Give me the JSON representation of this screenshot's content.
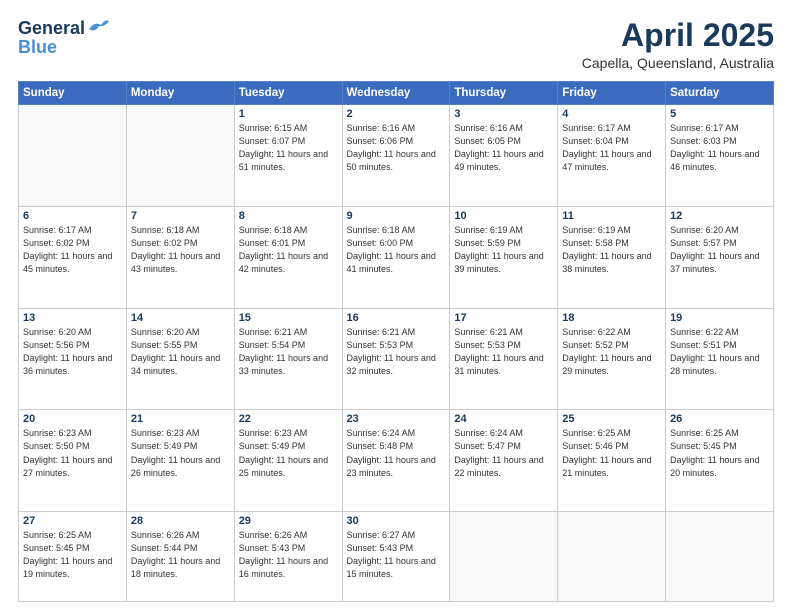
{
  "logo": {
    "general": "General",
    "blue": "Blue"
  },
  "header": {
    "month": "April 2025",
    "location": "Capella, Queensland, Australia"
  },
  "weekdays": [
    "Sunday",
    "Monday",
    "Tuesday",
    "Wednesday",
    "Thursday",
    "Friday",
    "Saturday"
  ],
  "weeks": [
    [
      {
        "day": "",
        "detail": ""
      },
      {
        "day": "",
        "detail": ""
      },
      {
        "day": "1",
        "detail": "Sunrise: 6:15 AM\nSunset: 6:07 PM\nDaylight: 11 hours and 51 minutes."
      },
      {
        "day": "2",
        "detail": "Sunrise: 6:16 AM\nSunset: 6:06 PM\nDaylight: 11 hours and 50 minutes."
      },
      {
        "day": "3",
        "detail": "Sunrise: 6:16 AM\nSunset: 6:05 PM\nDaylight: 11 hours and 49 minutes."
      },
      {
        "day": "4",
        "detail": "Sunrise: 6:17 AM\nSunset: 6:04 PM\nDaylight: 11 hours and 47 minutes."
      },
      {
        "day": "5",
        "detail": "Sunrise: 6:17 AM\nSunset: 6:03 PM\nDaylight: 11 hours and 46 minutes."
      }
    ],
    [
      {
        "day": "6",
        "detail": "Sunrise: 6:17 AM\nSunset: 6:02 PM\nDaylight: 11 hours and 45 minutes."
      },
      {
        "day": "7",
        "detail": "Sunrise: 6:18 AM\nSunset: 6:02 PM\nDaylight: 11 hours and 43 minutes."
      },
      {
        "day": "8",
        "detail": "Sunrise: 6:18 AM\nSunset: 6:01 PM\nDaylight: 11 hours and 42 minutes."
      },
      {
        "day": "9",
        "detail": "Sunrise: 6:18 AM\nSunset: 6:00 PM\nDaylight: 11 hours and 41 minutes."
      },
      {
        "day": "10",
        "detail": "Sunrise: 6:19 AM\nSunset: 5:59 PM\nDaylight: 11 hours and 39 minutes."
      },
      {
        "day": "11",
        "detail": "Sunrise: 6:19 AM\nSunset: 5:58 PM\nDaylight: 11 hours and 38 minutes."
      },
      {
        "day": "12",
        "detail": "Sunrise: 6:20 AM\nSunset: 5:57 PM\nDaylight: 11 hours and 37 minutes."
      }
    ],
    [
      {
        "day": "13",
        "detail": "Sunrise: 6:20 AM\nSunset: 5:56 PM\nDaylight: 11 hours and 36 minutes."
      },
      {
        "day": "14",
        "detail": "Sunrise: 6:20 AM\nSunset: 5:55 PM\nDaylight: 11 hours and 34 minutes."
      },
      {
        "day": "15",
        "detail": "Sunrise: 6:21 AM\nSunset: 5:54 PM\nDaylight: 11 hours and 33 minutes."
      },
      {
        "day": "16",
        "detail": "Sunrise: 6:21 AM\nSunset: 5:53 PM\nDaylight: 11 hours and 32 minutes."
      },
      {
        "day": "17",
        "detail": "Sunrise: 6:21 AM\nSunset: 5:53 PM\nDaylight: 11 hours and 31 minutes."
      },
      {
        "day": "18",
        "detail": "Sunrise: 6:22 AM\nSunset: 5:52 PM\nDaylight: 11 hours and 29 minutes."
      },
      {
        "day": "19",
        "detail": "Sunrise: 6:22 AM\nSunset: 5:51 PM\nDaylight: 11 hours and 28 minutes."
      }
    ],
    [
      {
        "day": "20",
        "detail": "Sunrise: 6:23 AM\nSunset: 5:50 PM\nDaylight: 11 hours and 27 minutes."
      },
      {
        "day": "21",
        "detail": "Sunrise: 6:23 AM\nSunset: 5:49 PM\nDaylight: 11 hours and 26 minutes."
      },
      {
        "day": "22",
        "detail": "Sunrise: 6:23 AM\nSunset: 5:49 PM\nDaylight: 11 hours and 25 minutes."
      },
      {
        "day": "23",
        "detail": "Sunrise: 6:24 AM\nSunset: 5:48 PM\nDaylight: 11 hours and 23 minutes."
      },
      {
        "day": "24",
        "detail": "Sunrise: 6:24 AM\nSunset: 5:47 PM\nDaylight: 11 hours and 22 minutes."
      },
      {
        "day": "25",
        "detail": "Sunrise: 6:25 AM\nSunset: 5:46 PM\nDaylight: 11 hours and 21 minutes."
      },
      {
        "day": "26",
        "detail": "Sunrise: 6:25 AM\nSunset: 5:45 PM\nDaylight: 11 hours and 20 minutes."
      }
    ],
    [
      {
        "day": "27",
        "detail": "Sunrise: 6:25 AM\nSunset: 5:45 PM\nDaylight: 11 hours and 19 minutes."
      },
      {
        "day": "28",
        "detail": "Sunrise: 6:26 AM\nSunset: 5:44 PM\nDaylight: 11 hours and 18 minutes."
      },
      {
        "day": "29",
        "detail": "Sunrise: 6:26 AM\nSunset: 5:43 PM\nDaylight: 11 hours and 16 minutes."
      },
      {
        "day": "30",
        "detail": "Sunrise: 6:27 AM\nSunset: 5:43 PM\nDaylight: 11 hours and 15 minutes."
      },
      {
        "day": "",
        "detail": ""
      },
      {
        "day": "",
        "detail": ""
      },
      {
        "day": "",
        "detail": ""
      }
    ]
  ]
}
